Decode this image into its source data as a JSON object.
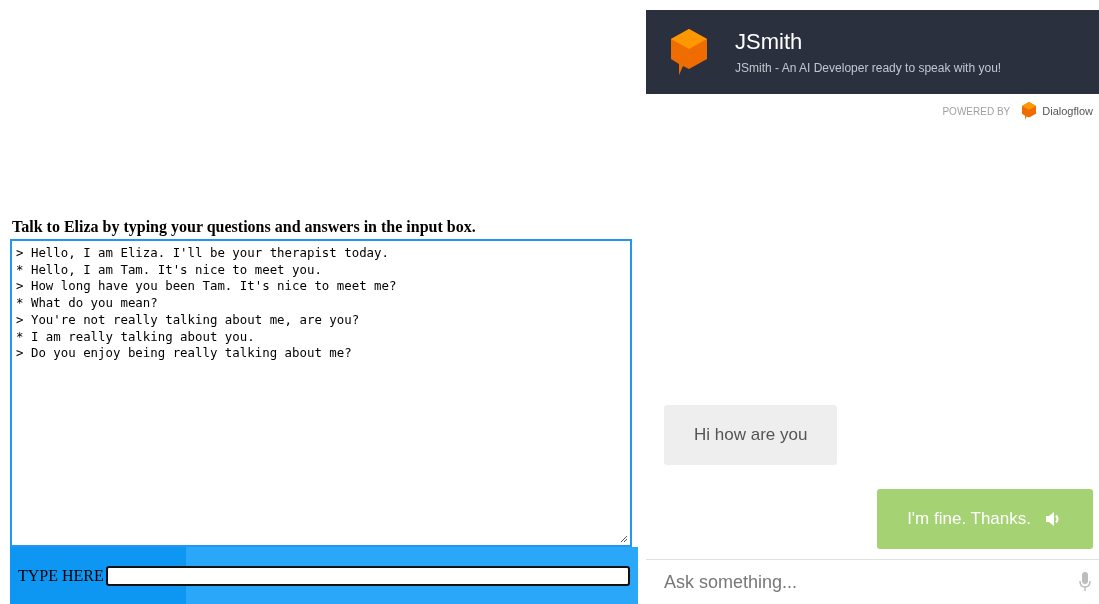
{
  "eliza": {
    "heading": "Talk to Eliza by typing your questions and answers in the input box.",
    "transcript": [
      "> Hello, I am Eliza. I'll be your therapist today.",
      "* Hello, I am Tam. It's nice to meet you.",
      "> How long have you been Tam. It's nice to meet me?",
      "* What do you mean?",
      "> You're not really talking about me, are you?",
      "* I am really talking about you.",
      "> Do you enjoy being really talking about me?"
    ],
    "input_label": "TYPE HERE"
  },
  "chat": {
    "agent_name": "JSmith",
    "agent_description": "JSmith - An AI Developer ready to speak with you!",
    "powered_by": "POWERED BY",
    "brand": "Dialogflow",
    "messages": [
      {
        "kind": "bot",
        "text": "Hi how are you"
      },
      {
        "kind": "user",
        "text": "I'm fine. Thanks."
      }
    ],
    "input": {
      "placeholder": "Ask something..."
    }
  }
}
